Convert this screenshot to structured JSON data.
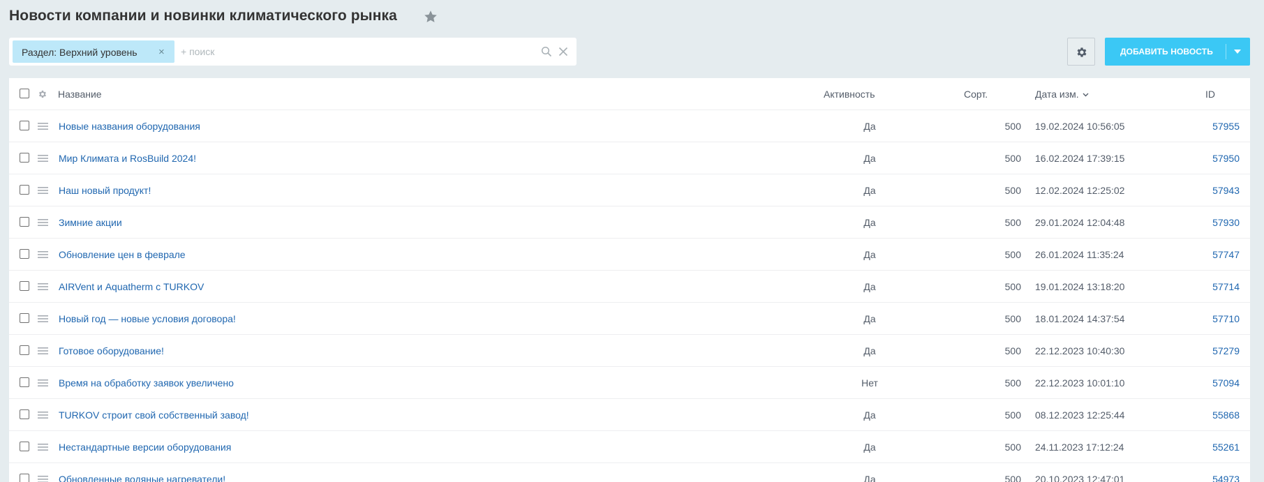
{
  "page": {
    "title": "Новости компании и новинки климатического рынка"
  },
  "filter": {
    "chip_label": "Раздел: Верхний уровень",
    "chip_remove": "×",
    "search_placeholder": "+ поиск"
  },
  "toolbar": {
    "add_label": "ДОБАВИТЬ НОВОСТЬ"
  },
  "table": {
    "columns": {
      "title": "Название",
      "active": "Активность",
      "sort": "Сорт.",
      "date": "Дата изм.",
      "id": "ID"
    },
    "rows": [
      {
        "title": "Новые названия оборудования",
        "active": "Да",
        "sort": "500",
        "date": "19.02.2024 10:56:05",
        "id": "57955"
      },
      {
        "title": "Мир Климата и RosBuild 2024!",
        "active": "Да",
        "sort": "500",
        "date": "16.02.2024 17:39:15",
        "id": "57950"
      },
      {
        "title": "Наш новый продукт!",
        "active": "Да",
        "sort": "500",
        "date": "12.02.2024 12:25:02",
        "id": "57943"
      },
      {
        "title": "Зимние акции",
        "active": "Да",
        "sort": "500",
        "date": "29.01.2024 12:04:48",
        "id": "57930"
      },
      {
        "title": "Обновление цен в феврале",
        "active": "Да",
        "sort": "500",
        "date": "26.01.2024 11:35:24",
        "id": "57747"
      },
      {
        "title": "AIRVent и Aquatherm с TURKOV",
        "active": "Да",
        "sort": "500",
        "date": "19.01.2024 13:18:20",
        "id": "57714"
      },
      {
        "title": "Новый год — новые условия договора!",
        "active": "Да",
        "sort": "500",
        "date": "18.01.2024 14:37:54",
        "id": "57710"
      },
      {
        "title": "Готовое оборудование!",
        "active": "Да",
        "sort": "500",
        "date": "22.12.2023 10:40:30",
        "id": "57279"
      },
      {
        "title": "Время на обработку заявок увеличено",
        "active": "Нет",
        "sort": "500",
        "date": "22.12.2023 10:01:10",
        "id": "57094"
      },
      {
        "title": "TURKOV строит свой собственный завод!",
        "active": "Да",
        "sort": "500",
        "date": "08.12.2023 12:25:44",
        "id": "55868"
      },
      {
        "title": "Нестандартные версии оборудования",
        "active": "Да",
        "sort": "500",
        "date": "24.11.2023 17:12:24",
        "id": "55261"
      },
      {
        "title": "Обновленные водяные нагреватели!",
        "active": "Да",
        "sort": "500",
        "date": "20.10.2023 12:47:01",
        "id": "54973"
      }
    ]
  },
  "colors": {
    "background": "#e5ecef",
    "accent": "#3bc8f5",
    "link": "#2067b0",
    "chip": "#bde8f9"
  },
  "icons": {
    "favorite": "star-icon",
    "search": "search-icon",
    "clear": "close-icon",
    "settings": "gear-icon",
    "dropdown": "chevron-down-icon",
    "row_menu": "drag-handle-icon"
  }
}
